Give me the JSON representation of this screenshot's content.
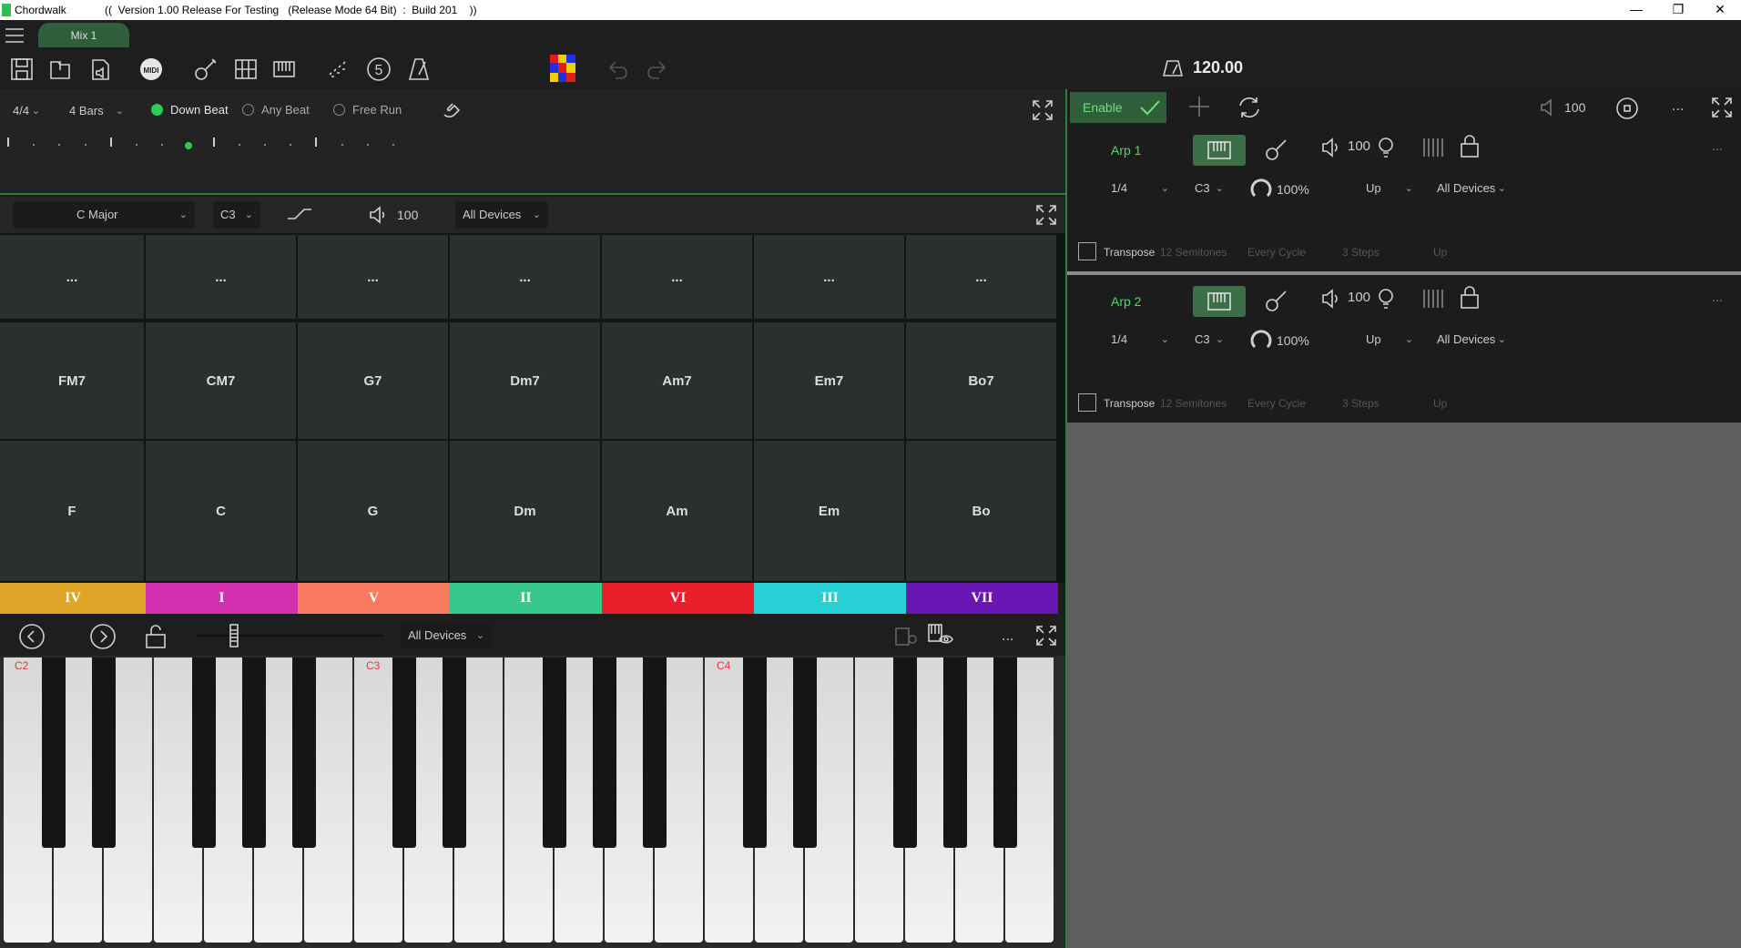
{
  "window": {
    "app_name": "Chordwalk",
    "version_text": "((  Version 1.00 Release For Testing   (Release Mode 64 Bit)  :  Build 201    ))"
  },
  "tabs": [
    {
      "label": "Mix 1"
    }
  ],
  "toolbar": {
    "bpm": "120.00",
    "midi_label": "MIDI",
    "chord_count": "5"
  },
  "beat": {
    "time_sig": "4/4",
    "bars": "4 Bars",
    "modes": [
      "Down Beat",
      "Any Beat",
      "Free Run"
    ],
    "selected_mode": "Down Beat",
    "active_step": 7
  },
  "scale": {
    "key": "C Major",
    "octave": "C3",
    "volume": "100",
    "device": "All Devices"
  },
  "pads": {
    "more_label": "...",
    "sevenths": [
      "FM7",
      "CM7",
      "G7",
      "Dm7",
      "Am7",
      "Em7",
      "Bo7"
    ],
    "triads": [
      "F",
      "C",
      "G",
      "Dm",
      "Am",
      "Em",
      "Bo"
    ],
    "degrees": [
      "IV",
      "I",
      "V",
      "II",
      "VI",
      "III",
      "VII"
    ],
    "degree_colors": [
      "#e0a428",
      "#d42fae",
      "#f87a60",
      "#38c88c",
      "#e81e2a",
      "#26d0d4",
      "#6a16b4"
    ]
  },
  "keyboard": {
    "device": "All Devices",
    "more_label": "...",
    "note_labels": [
      "C2",
      "C3",
      "C4"
    ]
  },
  "arp_panel": {
    "enable_label": "Enable",
    "volume": "100",
    "more_label": "..."
  },
  "arps": [
    {
      "name": "Arp 1",
      "volume": "100",
      "rate": "1/4",
      "octave": "C3",
      "gate": "100%",
      "direction": "Up",
      "device": "All Devices",
      "transpose_label": "Transpose",
      "semitones": "12 Semitones",
      "cycle": "Every Cycle",
      "steps": "3 Steps",
      "transpose_dir": "Up",
      "more_label": "..."
    },
    {
      "name": "Arp 2",
      "volume": "100",
      "rate": "1/4",
      "octave": "C3",
      "gate": "100%",
      "direction": "Up",
      "device": "All Devices",
      "transpose_label": "Transpose",
      "semitones": "12 Semitones",
      "cycle": "Every Cycle",
      "steps": "3 Steps",
      "transpose_dir": "Up",
      "more_label": "..."
    }
  ]
}
